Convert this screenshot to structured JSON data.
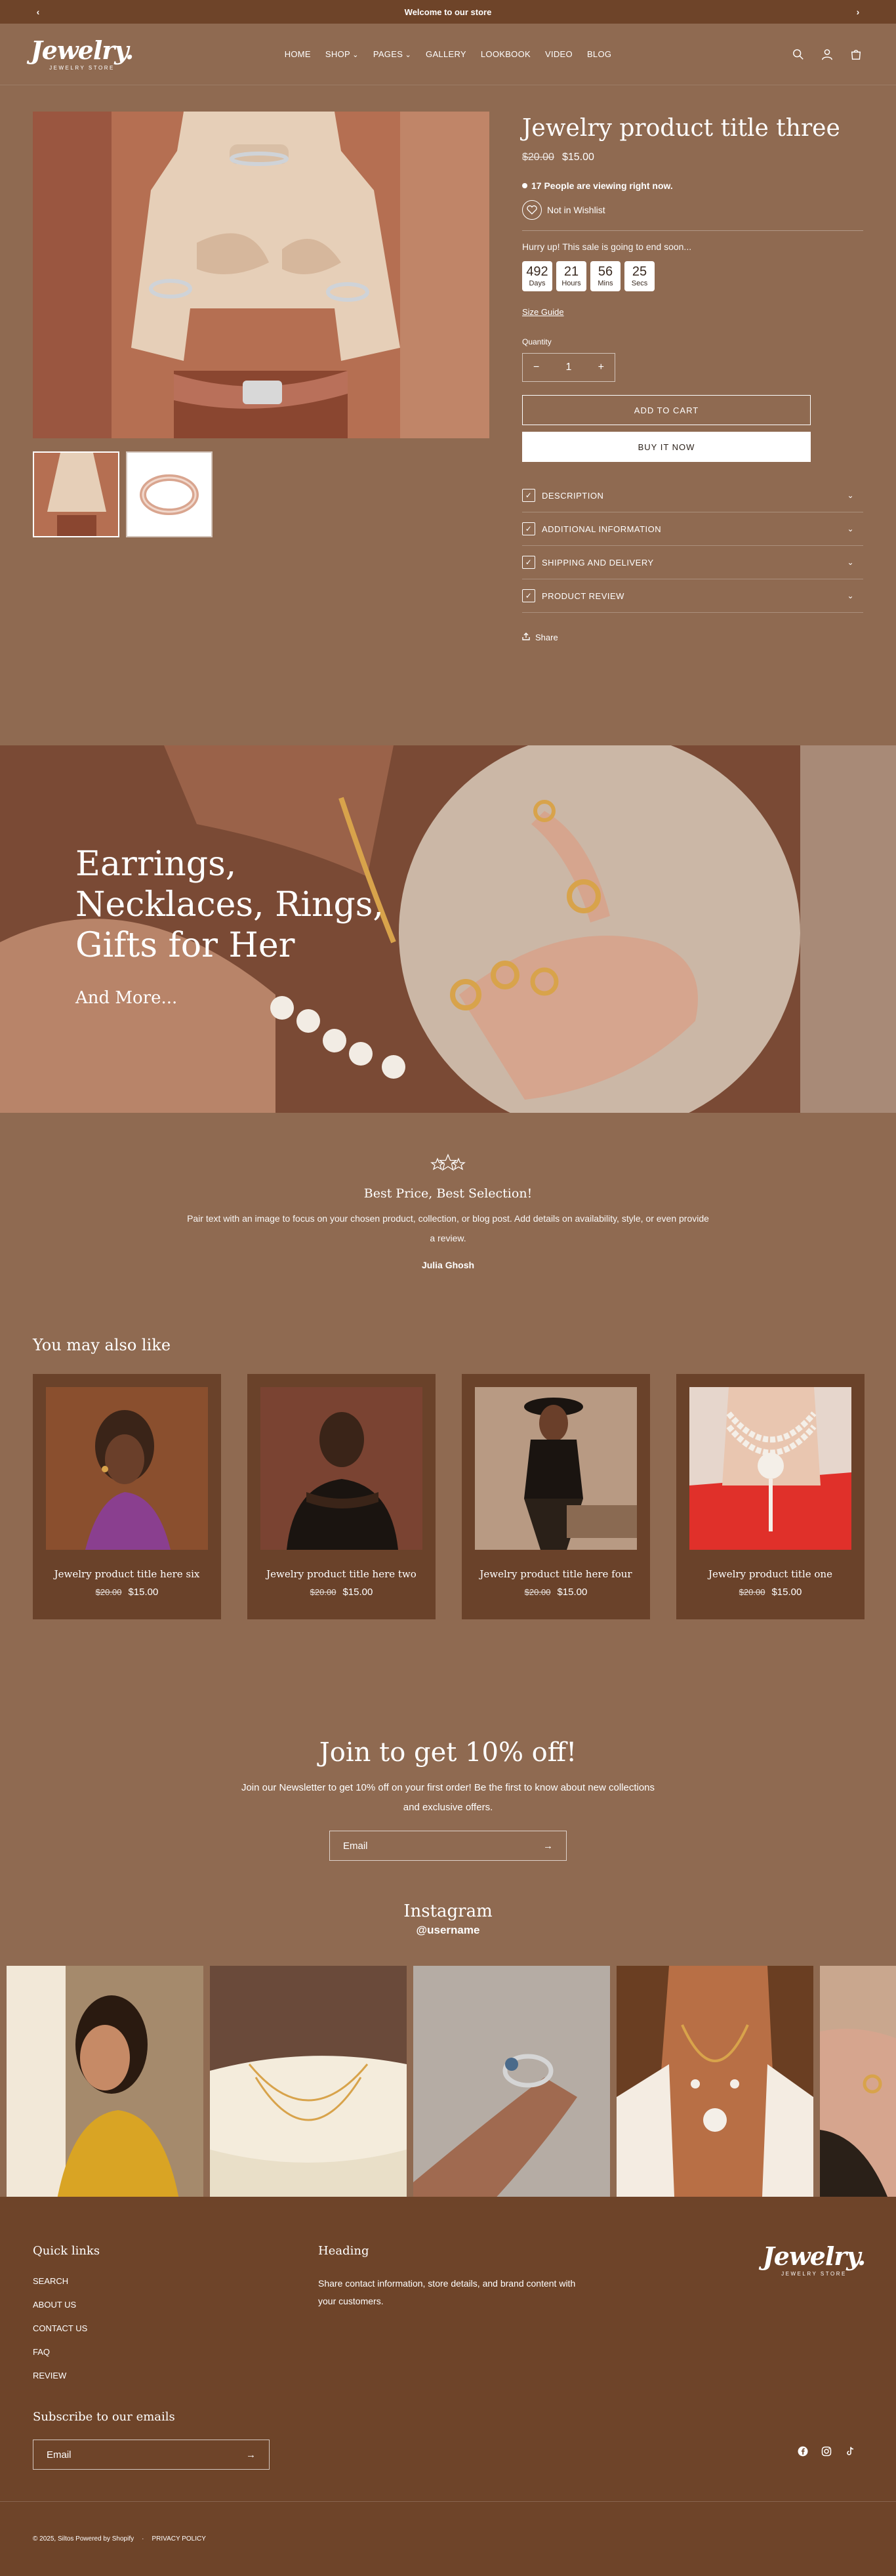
{
  "announcement": {
    "text": "Welcome to our store"
  },
  "brand": {
    "name": "Jewelry.",
    "tagline": "JEWELRY STORE"
  },
  "nav": {
    "items": [
      "HOME",
      "SHOP",
      "PAGES",
      "GALLERY",
      "LOOKBOOK",
      "VIDEO",
      "BLOG"
    ]
  },
  "header_icons": [
    "search-icon",
    "account-icon",
    "cart-icon"
  ],
  "product": {
    "title": "Jewelry product title three",
    "price_old": "$20.00",
    "price": "$15.00",
    "viewing": "17 People are viewing right now.",
    "wishlist": "Not in Wishlist",
    "hurry": "Hurry up! This sale is going to end soon...",
    "countdown": [
      {
        "value": "492",
        "label": "Days"
      },
      {
        "value": "21",
        "label": "Hours"
      },
      {
        "value": "56",
        "label": "Mins"
      },
      {
        "value": "25",
        "label": "Secs"
      }
    ],
    "size_guide": "Size Guide",
    "quantity_label": "Quantity",
    "quantity": "1",
    "add_to_cart": "ADD TO CART",
    "buy_now": "BUY IT NOW",
    "accordion": [
      "DESCRIPTION",
      "ADDITIONAL INFORMATION",
      "SHIPPING AND DELIVERY",
      "PRODUCT REVIEW"
    ],
    "share": "Share"
  },
  "banner": {
    "title": "Earrings, Necklaces, Rings, Gifts for Her",
    "subtitle": "And More..."
  },
  "testimonial": {
    "heading": "Best Price, Best Selection!",
    "text": "Pair text with an image to focus on your chosen product, collection, or blog post. Add details on availability, style, or even provide a review.",
    "author": "Julia Ghosh"
  },
  "related": {
    "heading": "You may also like",
    "items": [
      {
        "title": "Jewelry product title here six",
        "old": "$20.00",
        "price": "$15.00"
      },
      {
        "title": "Jewelry product title here two",
        "old": "$20.00",
        "price": "$15.00"
      },
      {
        "title": "Jewelry product title here four",
        "old": "$20.00",
        "price": "$15.00"
      },
      {
        "title": "Jewelry product title one",
        "old": "$20.00",
        "price": "$15.00"
      }
    ]
  },
  "newsletter": {
    "heading": "Join to get 10% off!",
    "text": "Join our Newsletter to get 10% off on your first order! Be the first to know about new collections and exclusive offers.",
    "placeholder": "Email"
  },
  "instagram": {
    "heading": "Instagram",
    "username": "@username"
  },
  "footer": {
    "quick_links_heading": "Quick links",
    "links": [
      "SEARCH",
      "ABOUT US",
      "CONTACT US",
      "FAQ",
      "REVIEW"
    ],
    "heading2": "Heading",
    "heading2_text": "Share contact information, store details, and brand content with your customers.",
    "subscribe_heading": "Subscribe to our emails",
    "email_placeholder": "Email",
    "social": [
      "facebook-icon",
      "instagram-icon",
      "tiktok-icon"
    ],
    "copyright": "© 2025, Siltos Powered by Shopify",
    "privacy": "PRIVACY POLICY"
  },
  "colors": {
    "background": "#8f6a51",
    "dark": "#6e4429",
    "card": "#6a422a",
    "text": "#ffffff"
  }
}
